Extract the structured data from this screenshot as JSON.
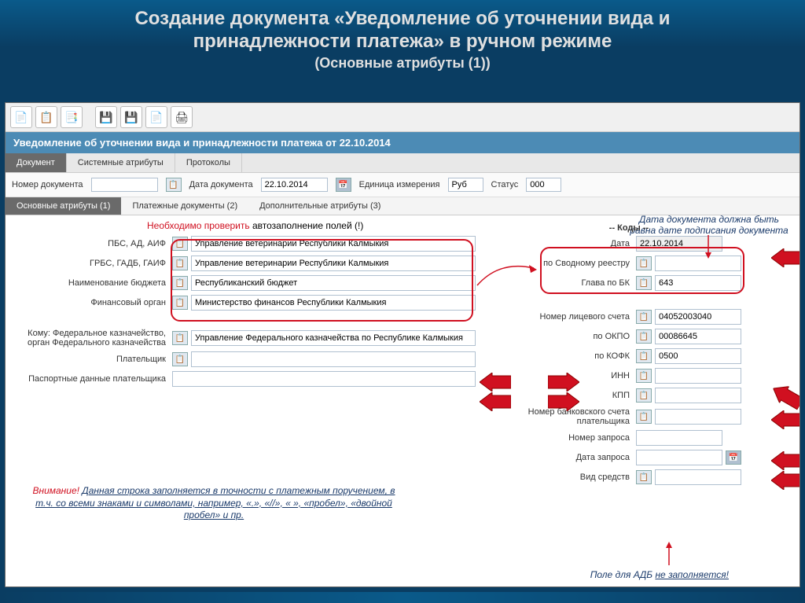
{
  "slide": {
    "title_l1": "Создание документа «Уведомление об уточнении вида и",
    "title_l2": "принадлежности платежа» в ручном режиме",
    "subtitle": "(Основные атрибуты (1))"
  },
  "toolbar": {
    "icons": [
      "📄",
      "📋",
      "📑",
      "💾",
      "💾",
      "📄",
      "🖨"
    ]
  },
  "window_title": "Уведомление об уточнении вида и принадлежности платежа от 22.10.2014",
  "tabs": {
    "doc": "Документ",
    "sys": "Системные атрибуты",
    "proto": "Протоколы"
  },
  "header_fields": {
    "num_label": "Номер документа",
    "num_value": "",
    "date_label": "Дата документа",
    "date_value": "22.10.2014",
    "unit_label": "Единица измерения",
    "unit_value": "Руб",
    "status_label": "Статус",
    "status_value": "000"
  },
  "subtabs": {
    "main": "Основные атрибуты (1)",
    "pay": "Платежные документы (2)",
    "add": "Дополнительные атрибуты (3)"
  },
  "annot_check_red": "Необходимо проверить ",
  "annot_check_black": "автозаполнение полей (!)",
  "left_fields": {
    "pbs_label": "ПБС, АД, АИФ",
    "pbs_value": "Управление ветеринарии Республики Калмыкия",
    "grbs_label": "ГРБС, ГАДБ, ГАИФ",
    "grbs_value": "Управление ветеринарии Республики Калмыкия",
    "budget_label": "Наименование бюджета",
    "budget_value": "Республиканский бюджет",
    "fin_label": "Финансовый орган",
    "fin_value": "Министерство финансов Республики Калмыкия",
    "komu_label": "Кому: Федеральное казначейство, орган Федерального казначейства",
    "komu_value": "Управление Федерального казначейства по Республике Калмыкия",
    "payer_label": "Плательщик",
    "payer_value": "",
    "passport_label": "Паспортные данные плательщика",
    "passport_value": ""
  },
  "right_fields": {
    "codes_header": "-- Коды --",
    "date_label": "Дата",
    "date_value": "22.10.2014",
    "svod_label": "по Сводному реестру",
    "svod_value": "",
    "glava_label": "Глава по БК",
    "glava_value": "643",
    "ls_label": "Номер лицевого счета",
    "ls_value": "04052003040",
    "okpo_label": "по ОКПО",
    "okpo_value": "00086645",
    "kofk_label": "по КОФК",
    "kofk_value": "0500",
    "inn_label": "ИНН",
    "inn_value": "",
    "kpp_label": "КПП",
    "kpp_value": "",
    "bank_label": "Номер банковского счета плательщика",
    "bank_value": "",
    "req_label": "Номер запроса",
    "req_value": "",
    "reqdate_label": "Дата запроса",
    "reqdate_value": "",
    "vid_label": "Вид средств",
    "vid_value": ""
  },
  "note_right_l1": "Дата документа должна быть",
  "note_right_l2": "равна дате подписания документа",
  "attention_red": "Внимание! ",
  "attention_text": "Данная строка заполняется в точности с платежным поручением, в т.ч. со всеми знаками и символами, например, «.», «//», « », «пробел», «двойной пробел» и пр.",
  "note_adb_pre": "Поле для АДБ ",
  "note_adb_ul": "не заполняется!"
}
